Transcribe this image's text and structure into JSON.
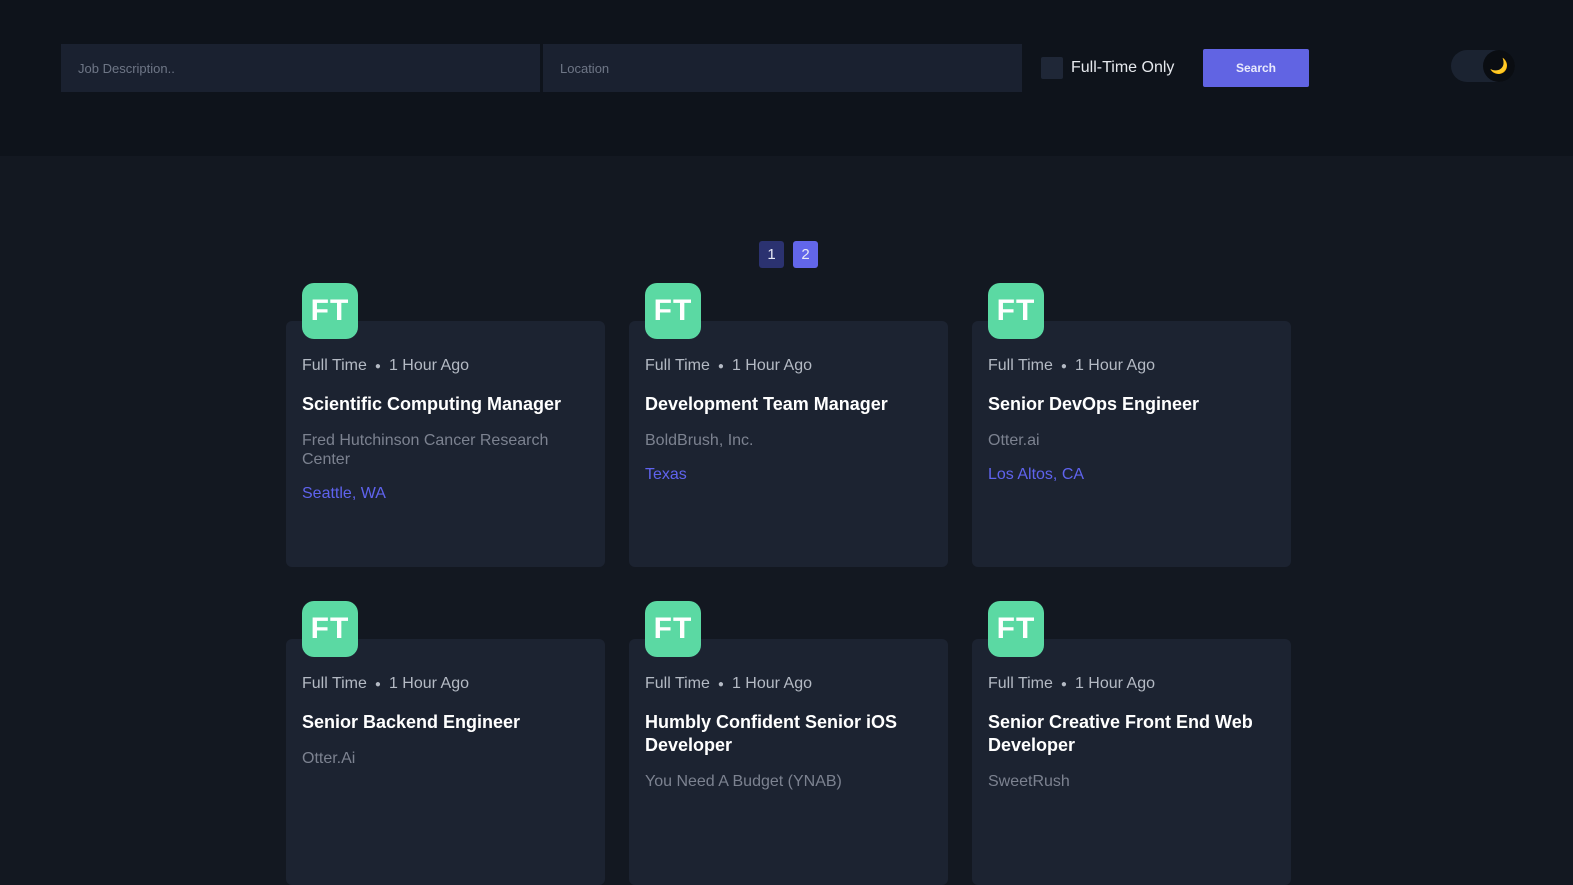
{
  "search": {
    "job_placeholder": "Job Description..",
    "location_placeholder": "Location",
    "fulltime_label": "Full-Time Only",
    "button_label": "Search"
  },
  "theme_toggle": {
    "icon": "moon-icon",
    "glyph": "🌙",
    "state": "dark"
  },
  "pagination": {
    "pages": [
      "1",
      "2"
    ],
    "current": "2"
  },
  "colors": {
    "accent": "#6164e3",
    "logo_bg": "#5bd9a3",
    "location_text": "#5f63ee",
    "card_bg": "#1c2331",
    "page_bg": "#131821",
    "header_bg": "#0e131b"
  },
  "jobs": [
    {
      "logo": "FT",
      "type": "Full Time",
      "posted": "1 Hour Ago",
      "title": "Scientific Computing Manager",
      "company": "Fred Hutchinson Cancer Research Center",
      "location": "Seattle, WA"
    },
    {
      "logo": "FT",
      "type": "Full Time",
      "posted": "1 Hour Ago",
      "title": "Development Team Manager",
      "company": "BoldBrush, Inc.",
      "location": "Texas"
    },
    {
      "logo": "FT",
      "type": "Full Time",
      "posted": "1 Hour Ago",
      "title": "Senior DevOps Engineer",
      "company": "Otter.ai",
      "location": "Los Altos, CA"
    },
    {
      "logo": "FT",
      "type": "Full Time",
      "posted": "1 Hour Ago",
      "title": "Senior Backend Engineer",
      "company": "Otter.Ai",
      "location": ""
    },
    {
      "logo": "FT",
      "type": "Full Time",
      "posted": "1 Hour Ago",
      "title": "Humbly Confident Senior iOS Developer",
      "company": "You Need A Budget (YNAB)",
      "location": ""
    },
    {
      "logo": "FT",
      "type": "Full Time",
      "posted": "1 Hour Ago",
      "title": "Senior Creative Front End Web Developer",
      "company": "SweetRush",
      "location": ""
    }
  ]
}
